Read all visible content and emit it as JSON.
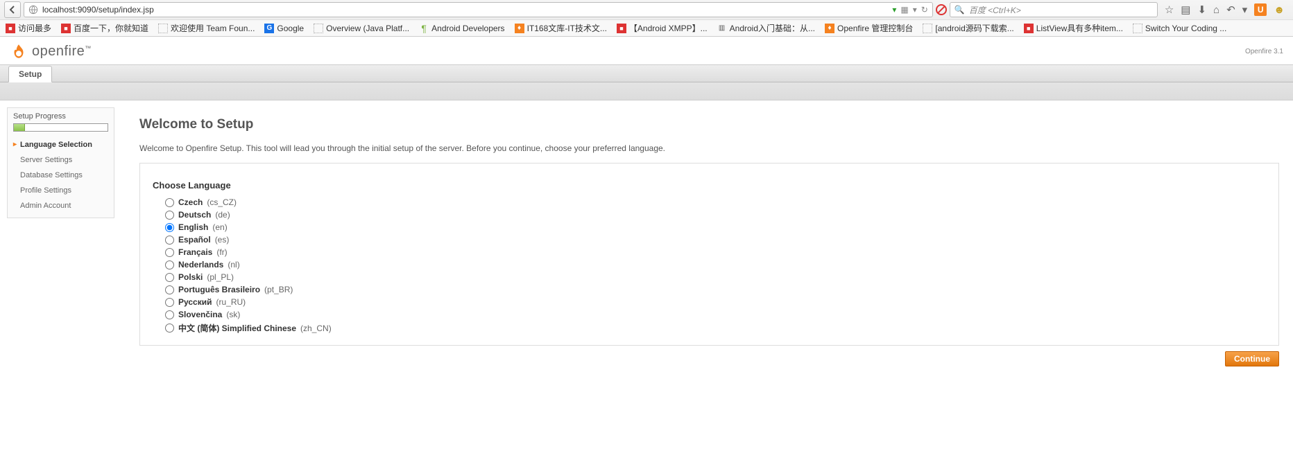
{
  "browser": {
    "url": "localhost:9090/setup/index.jsp",
    "search_placeholder": "百度 <Ctrl+K>"
  },
  "bookmarks": [
    {
      "label": "访问最多",
      "icon": "red"
    },
    {
      "label": "百度一下，你就知道",
      "icon": "red"
    },
    {
      "label": "欢迎使用 Team Foun...",
      "icon": "dot"
    },
    {
      "label": "Google",
      "icon": "blue"
    },
    {
      "label": "Overview (Java Platf...",
      "icon": "dot"
    },
    {
      "label": "Android Developers",
      "icon": "green"
    },
    {
      "label": "IT168文库-IT技术文...",
      "icon": "orange"
    },
    {
      "label": "【Android XMPP】...",
      "icon": "red"
    },
    {
      "label": "Android入门基础：从...",
      "icon": "book"
    },
    {
      "label": "Openfire 管理控制台",
      "icon": "orange"
    },
    {
      "label": "[android源码下载索...",
      "icon": "dot"
    },
    {
      "label": "ListView具有多种item...",
      "icon": "red"
    },
    {
      "label": "Switch Your Coding ...",
      "icon": "dot"
    }
  ],
  "app": {
    "logo_text": "openfire",
    "version": "Openfire 3.1"
  },
  "tabs": {
    "setup": "Setup"
  },
  "sidebar": {
    "title": "Setup Progress",
    "steps": [
      {
        "label": "Language Selection",
        "active": true
      },
      {
        "label": "Server Settings",
        "active": false
      },
      {
        "label": "Database Settings",
        "active": false
      },
      {
        "label": "Profile Settings",
        "active": false
      },
      {
        "label": "Admin Account",
        "active": false
      }
    ]
  },
  "page": {
    "title": "Welcome to Setup",
    "intro": "Welcome to Openfire Setup. This tool will lead you through the initial setup of the server. Before you continue, choose your preferred language.",
    "choose_label": "Choose Language",
    "continue_label": "Continue"
  },
  "languages": [
    {
      "name": "Czech",
      "code": "(cs_CZ)",
      "checked": false
    },
    {
      "name": "Deutsch",
      "code": "(de)",
      "checked": false
    },
    {
      "name": "English",
      "code": "(en)",
      "checked": true
    },
    {
      "name": "Español",
      "code": "(es)",
      "checked": false
    },
    {
      "name": "Français",
      "code": "(fr)",
      "checked": false
    },
    {
      "name": "Nederlands",
      "code": "(nl)",
      "checked": false
    },
    {
      "name": "Polski",
      "code": "(pl_PL)",
      "checked": false
    },
    {
      "name": "Português Brasileiro",
      "code": "(pt_BR)",
      "checked": false
    },
    {
      "name": "Русский",
      "code": "(ru_RU)",
      "checked": false
    },
    {
      "name": "Slovenčina",
      "code": "(sk)",
      "checked": false
    },
    {
      "name": "中文 (简体)  Simplified Chinese",
      "code": "(zh_CN)",
      "checked": false
    }
  ]
}
